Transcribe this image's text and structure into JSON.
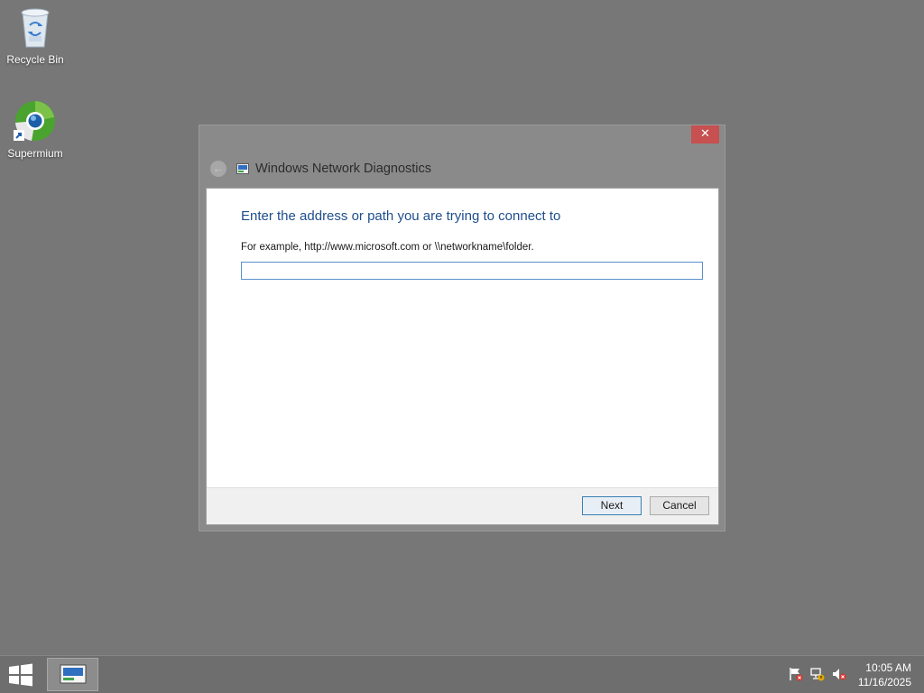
{
  "desktop": {
    "icons": [
      {
        "label": "Recycle Bin",
        "icon": "recycle-bin-icon"
      },
      {
        "label": "Supermium",
        "icon": "supermium-browser-icon"
      }
    ]
  },
  "dialog": {
    "close_label": "✕",
    "title": "Windows Network Diagnostics",
    "heading": "Enter the address or path you are trying to connect to",
    "hint": "For example, http://www.microsoft.com or \\\\networkname\\folder.",
    "address_value": "",
    "address_placeholder": "",
    "buttons": {
      "next": "Next",
      "cancel": "Cancel"
    }
  },
  "taskbar": {
    "clock": {
      "time": "10:05 AM",
      "date": "11/16/2025"
    },
    "tray_icons": [
      "action-center-flag-icon",
      "network-icon",
      "volume-muted-icon"
    ]
  },
  "colors": {
    "desktop_bg": "#777777",
    "heading_blue": "#1e4e8c",
    "close_red": "#c75050",
    "input_border": "#5b8fcb"
  }
}
